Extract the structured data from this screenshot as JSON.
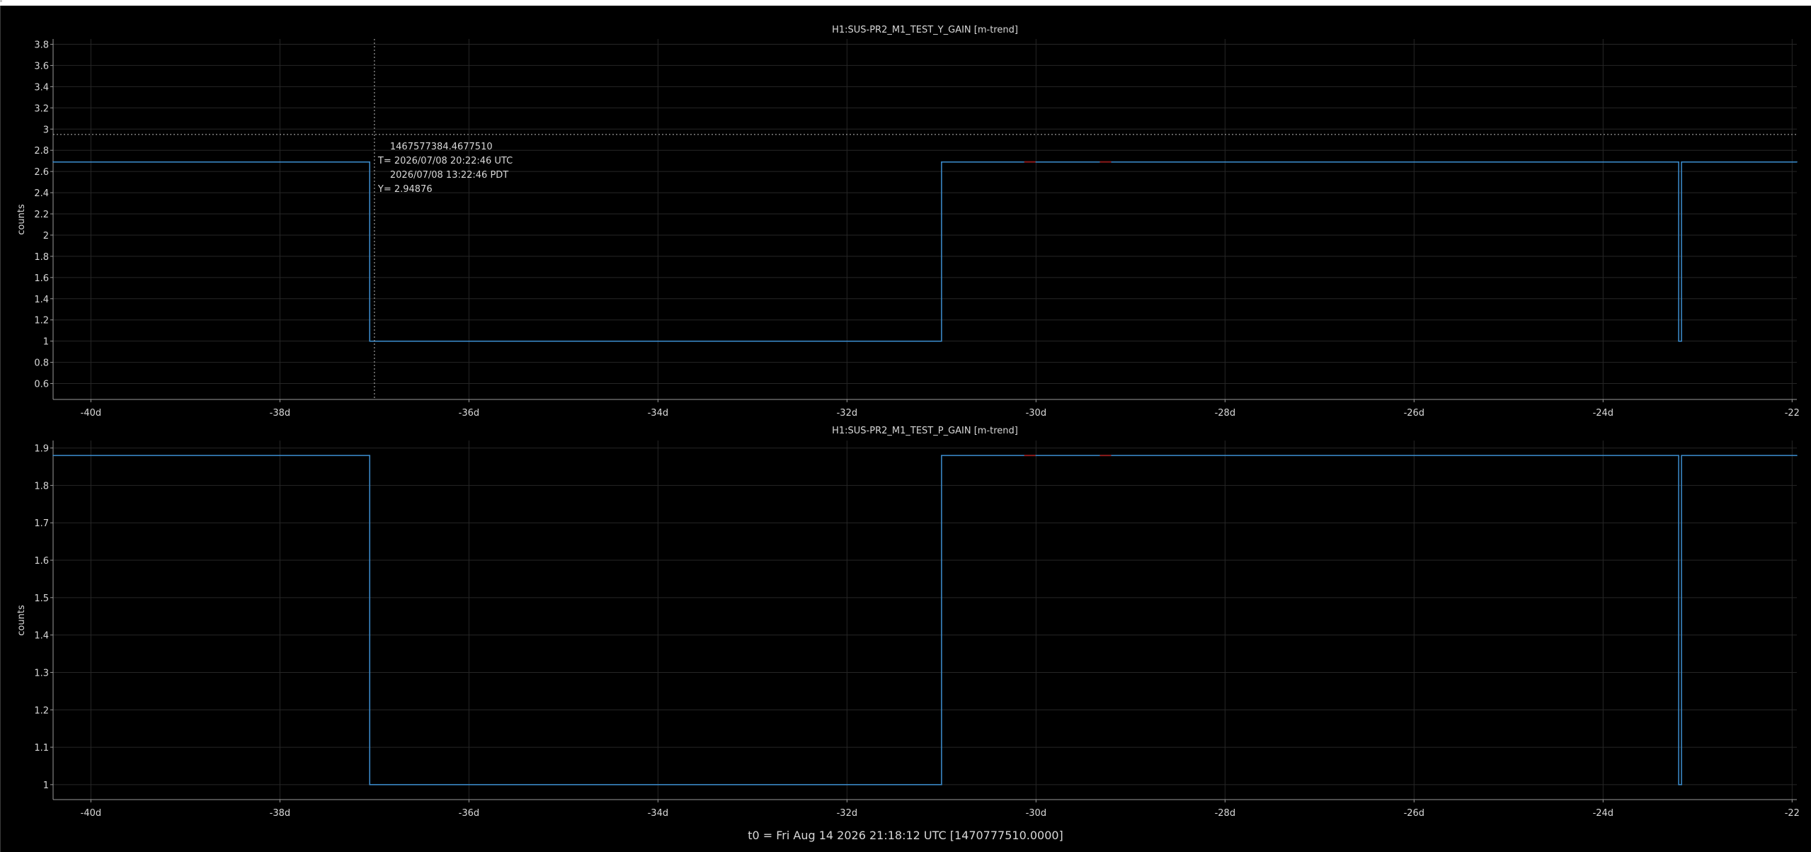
{
  "footer": {
    "t0_text": "t0 = Fri Aug 14 2026 21:18:12 UTC [1470777510.0000]"
  },
  "colors": {
    "background": "#000000",
    "trace": "#3d8fd1",
    "grid": "#262626",
    "axis": "#9a9a9a",
    "text": "#d8d8d8",
    "marker": "#8b1a1a"
  },
  "cursor": {
    "gps_text": "1467577384.4677510",
    "utc_text": "T= 2026/07/08 20:22:46 UTC",
    "pdt_text": "2026/07/08 13:22:46 PDT",
    "y_text": "Y= 2.94876",
    "x_days": -37.0,
    "y_value": 2.94876
  },
  "chart_data": [
    {
      "type": "line",
      "title": "H1:SUS-PR2_M1_TEST_Y_GAIN [m-trend]",
      "xlabel": "",
      "ylabel": "counts",
      "xlim": [
        -40.4,
        -21.95
      ],
      "ylim": [
        0.45,
        3.85
      ],
      "x_ticks": [
        -40,
        -38,
        -36,
        -34,
        -32,
        -30,
        -28,
        -26,
        -24,
        -22
      ],
      "x_tick_labels": [
        "-40d",
        "-38d",
        "-36d",
        "-34d",
        "-32d",
        "-30d",
        "-28d",
        "-26d",
        "-24d",
        "-22"
      ],
      "y_ticks": [
        0.6,
        0.8,
        1,
        1.2,
        1.4,
        1.6,
        1.8,
        2,
        2.2,
        2.4,
        2.6,
        2.8,
        3,
        3.2,
        3.4,
        3.6,
        3.8
      ],
      "y_tick_labels": [
        "0.6",
        "0.8",
        "1",
        "1.2",
        "1.4",
        "1.6",
        "1.8",
        "2",
        "2.2",
        "2.4",
        "2.6",
        "2.8",
        "3",
        "3.2",
        "3.4",
        "3.6",
        "3.8"
      ],
      "grid": true,
      "series": [
        {
          "x": [
            -40.4,
            -37.05,
            -37.05,
            -31.0,
            -31.0,
            -23.2,
            -23.2,
            -23.17,
            -23.17,
            -21.95
          ],
          "y": [
            2.69,
            2.69,
            1.0,
            1.0,
            2.69,
            2.69,
            1.0,
            1.0,
            2.69,
            2.69
          ]
        }
      ]
    },
    {
      "type": "line",
      "title": "H1:SUS-PR2_M1_TEST_P_GAIN [m-trend]",
      "xlabel": "",
      "ylabel": "counts",
      "xlim": [
        -40.4,
        -21.95
      ],
      "ylim": [
        0.96,
        1.92
      ],
      "x_ticks": [
        -40,
        -38,
        -36,
        -34,
        -32,
        -30,
        -28,
        -26,
        -24,
        -22
      ],
      "x_tick_labels": [
        "-40d",
        "-38d",
        "-36d",
        "-34d",
        "-32d",
        "-30d",
        "-28d",
        "-26d",
        "-24d",
        "-22"
      ],
      "y_ticks": [
        1,
        1.1,
        1.2,
        1.3,
        1.4,
        1.5,
        1.6,
        1.7,
        1.8,
        1.9
      ],
      "y_tick_labels": [
        "1",
        "1.1",
        "1.2",
        "1.3",
        "1.4",
        "1.5",
        "1.6",
        "1.7",
        "1.8",
        "1.9"
      ],
      "grid": true,
      "series": [
        {
          "x": [
            -40.4,
            -37.05,
            -37.05,
            -31.0,
            -31.0,
            -23.2,
            -23.2,
            -23.17,
            -23.17,
            -21.95
          ],
          "y": [
            1.88,
            1.88,
            1.0,
            1.0,
            1.88,
            1.88,
            1.0,
            1.0,
            1.88,
            1.88
          ]
        }
      ]
    }
  ]
}
